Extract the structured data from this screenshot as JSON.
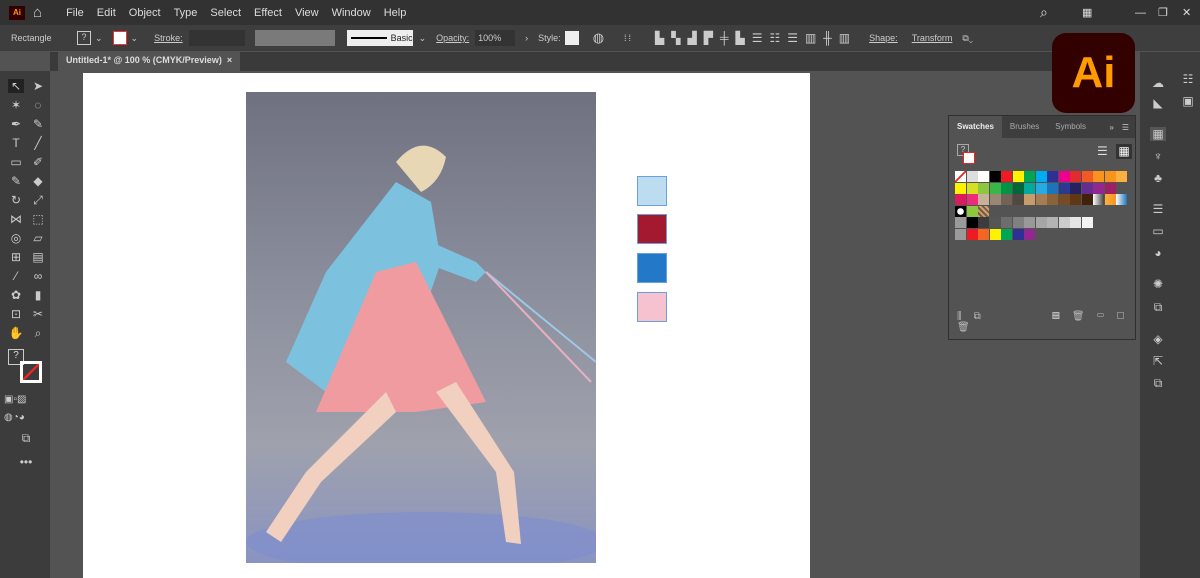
{
  "menubar": {
    "app_icon": "Ai",
    "items": [
      "File",
      "Edit",
      "Object",
      "Type",
      "Select",
      "Effect",
      "View",
      "Window",
      "Help"
    ]
  },
  "control": {
    "object_type": "Rectangle",
    "stroke_label": "Stroke:",
    "brush": "Basic",
    "opacity_label": "Opacity:",
    "opacity_value": "100%",
    "style_label": "Style:",
    "shape_label": "Shape:",
    "transform_label": "Transform"
  },
  "document": {
    "tab_title": "Untitled-1* @ 100 % (CMYK/Preview)",
    "close": "×"
  },
  "selected_swatches": [
    "#bcdcf0",
    "#a3192f",
    "#2379c8",
    "#f6c2cf"
  ],
  "logo": {
    "text": "Ai",
    "bg": "#330000",
    "fg": "#ff9a00"
  },
  "swatches_panel": {
    "tabs": [
      "Swatches",
      "Brushes",
      "Symbols"
    ],
    "active_tab": "Swatches",
    "rows": [
      [
        "none",
        "reg",
        "#ffffff",
        "#000000",
        "#ed1c24",
        "#fff200",
        "#00a651",
        "#00aeef",
        "#2e3192",
        "#ec008c",
        "#e22b2b",
        "#f15a24",
        "#f7931e",
        "#f7941d",
        "#fbb040"
      ],
      [
        "#fff200",
        "#d7df23",
        "#8dc63f",
        "#39b54a",
        "#009444",
        "#006838",
        "#00a99d",
        "#27aae1",
        "#1c75bc",
        "#2b3990",
        "#262262",
        "#662d91",
        "#92278f",
        "#9e1f63"
      ],
      [
        "#da1c5c",
        "#ee2a7b",
        "#c7b299",
        "#998675",
        "#736357",
        "#534741",
        "#c69c6d",
        "#a67c52",
        "#8c6239",
        "#754c24",
        "#603813",
        "#42210b",
        "grad-gray",
        "grad-orange",
        "grad-blue"
      ],
      [
        "pattern1",
        "pattern2",
        "pattern3"
      ],
      [
        "folder",
        "#000000",
        "#3c3c3c",
        "#555555",
        "#6d6d6d",
        "#808080",
        "#999999",
        "#a6a6a6",
        "#b3b3b3",
        "#cccccc",
        "#e6e6e6",
        "#f2f2f2"
      ],
      [
        "folder",
        "#ed1c24",
        "#f26522",
        "#fff200",
        "#00a651",
        "#2e3192",
        "#92278f"
      ]
    ]
  }
}
